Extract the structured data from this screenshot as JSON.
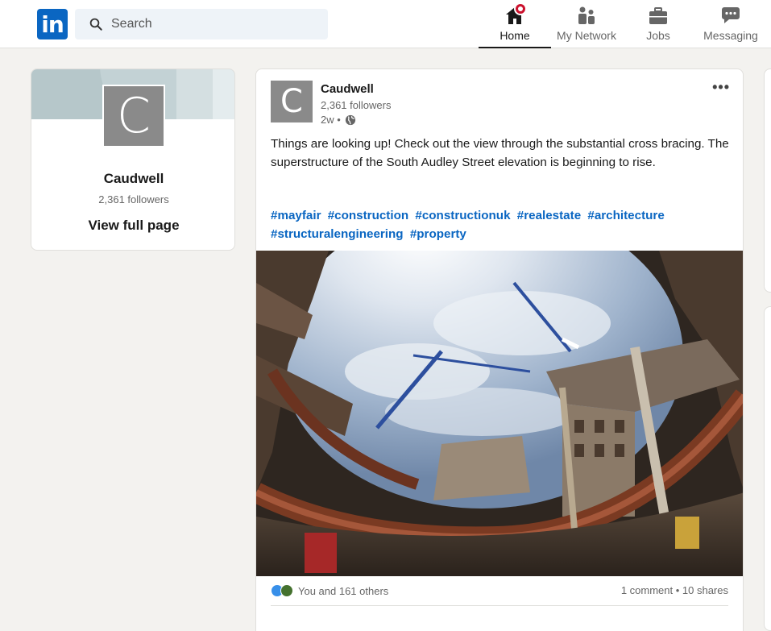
{
  "nav": {
    "logo_text": "in",
    "search_placeholder": "Search",
    "items": [
      {
        "label": "Home",
        "icon": "home-icon",
        "active": true
      },
      {
        "label": "My Network",
        "icon": "network-icon"
      },
      {
        "label": "Jobs",
        "icon": "briefcase-icon"
      },
      {
        "label": "Messaging",
        "icon": "message-icon"
      }
    ]
  },
  "company_card": {
    "logo_letter": "C",
    "name": "Caudwell",
    "followers": "2,361 followers",
    "view_link": "View full page"
  },
  "post": {
    "logo_letter": "C",
    "author": "Caudwell",
    "followers": "2,361 followers",
    "time": "2w •",
    "menu": "•••",
    "text": "Things are looking up! Check out the view through the substantial cross bracing. The superstructure of the South Audley Street elevation is beginning to rise.",
    "hashtags": [
      "#mayfair",
      "#construction",
      "#constructionuk",
      "#realestate",
      "#architecture",
      "#structuralengineering",
      "#property"
    ],
    "reactions_text": "You and 161 others",
    "social_counts": "1 comment • 10 shares"
  },
  "colors": {
    "brand": "#0a66c2",
    "background": "#f3f2ef",
    "notification": "#cb112d"
  }
}
